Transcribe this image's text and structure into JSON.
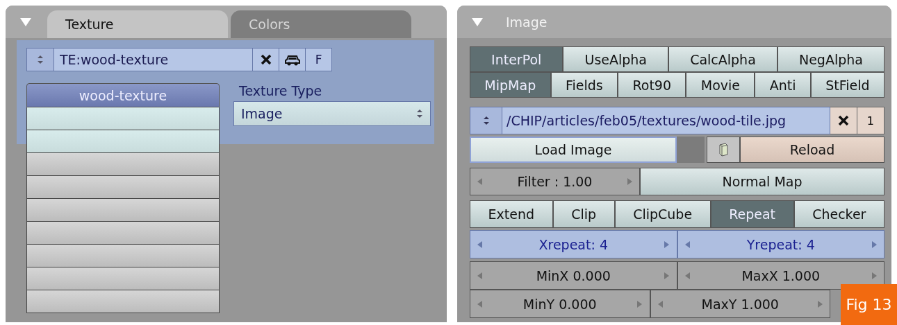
{
  "texture_panel": {
    "expanded": true,
    "tabs": [
      {
        "label": "Texture",
        "selected": true
      },
      {
        "label": "Colors",
        "selected": false
      }
    ],
    "datablock": {
      "value": "TE:wood-texture",
      "buttons": [
        "F"
      ]
    },
    "texture_list": {
      "header": "wood-texture",
      "slots": [
        {
          "highlighted": true
        },
        {
          "highlighted": true
        },
        {
          "highlighted": false
        },
        {
          "highlighted": false
        },
        {
          "highlighted": false
        },
        {
          "highlighted": false
        },
        {
          "highlighted": false
        },
        {
          "highlighted": false
        },
        {
          "highlighted": false
        }
      ]
    },
    "texture_type": {
      "label": "Texture Type",
      "value": "Image"
    }
  },
  "image_panel": {
    "expanded": true,
    "title": "Image",
    "toggle_rows": [
      [
        {
          "label": "InterPol",
          "on": true
        },
        {
          "label": "UseAlpha",
          "on": false
        },
        {
          "label": "CalcAlpha",
          "on": false
        },
        {
          "label": "NegAlpha",
          "on": false
        }
      ],
      [
        {
          "label": "MipMap",
          "on": true
        },
        {
          "label": "Fields",
          "on": false
        },
        {
          "label": "Rot90",
          "on": false
        },
        {
          "label": "Movie",
          "on": false
        },
        {
          "label": "Anti",
          "on": false
        },
        {
          "label": "StField",
          "on": false
        }
      ]
    ],
    "file": {
      "path": "/CHIP/articles/feb05/textures/wood-tile.jpg",
      "users": "1"
    },
    "load_button": "Load Image",
    "reload_button": "Reload",
    "filter": "Filter : 1.00",
    "normal_map": "Normal Map",
    "extend_modes": [
      {
        "label": "Extend",
        "selected": false
      },
      {
        "label": "Clip",
        "selected": false
      },
      {
        "label": "ClipCube",
        "selected": false
      },
      {
        "label": "Repeat",
        "selected": true
      },
      {
        "label": "Checker",
        "selected": false
      }
    ],
    "number_rows": [
      [
        {
          "label": "Xrepeat: 4",
          "active": true
        },
        {
          "label": "Yrepeat: 4",
          "active": true
        }
      ],
      [
        {
          "label": "MinX 0.000",
          "active": false
        },
        {
          "label": "MaxX 1.000",
          "active": false
        }
      ],
      [
        {
          "label": "MinY 0.000",
          "active": false
        },
        {
          "label": "MaxY 1.000",
          "active": false
        }
      ]
    ]
  },
  "figure_label": "Fig 13"
}
